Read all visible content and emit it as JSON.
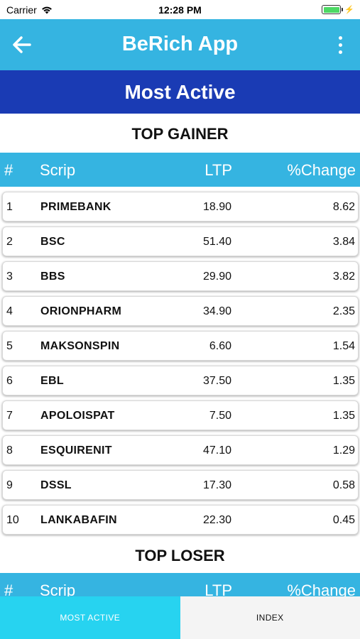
{
  "status_bar": {
    "carrier": "Carrier",
    "time": "12:28 PM"
  },
  "app_bar": {
    "title": "BeRich App",
    "back_icon": "arrow-left-icon",
    "menu_icon": "more-vertical-icon"
  },
  "section": {
    "title": "Most Active"
  },
  "columns": {
    "num": "#",
    "scrip": "Scrip",
    "ltp": "LTP",
    "change": "%Change"
  },
  "top_gainer": {
    "title": "TOP GAINER",
    "rows": [
      {
        "num": "1",
        "scrip": "PRIMEBANK",
        "ltp": "18.90",
        "change": "8.62"
      },
      {
        "num": "2",
        "scrip": "BSC",
        "ltp": "51.40",
        "change": "3.84"
      },
      {
        "num": "3",
        "scrip": "BBS",
        "ltp": "29.90",
        "change": "3.82"
      },
      {
        "num": "4",
        "scrip": "ORIONPHARM",
        "ltp": "34.90",
        "change": "2.35"
      },
      {
        "num": "5",
        "scrip": "MAKSONSPIN",
        "ltp": "6.60",
        "change": "1.54"
      },
      {
        "num": "6",
        "scrip": "EBL",
        "ltp": "37.50",
        "change": "1.35"
      },
      {
        "num": "7",
        "scrip": "APOLOISPAT",
        "ltp": "7.50",
        "change": "1.35"
      },
      {
        "num": "8",
        "scrip": "ESQUIRENIT",
        "ltp": "47.10",
        "change": "1.29"
      },
      {
        "num": "9",
        "scrip": "DSSL",
        "ltp": "17.30",
        "change": "0.58"
      },
      {
        "num": "10",
        "scrip": "LANKABAFIN",
        "ltp": "22.30",
        "change": "0.45"
      }
    ]
  },
  "top_loser": {
    "title": "TOP LOSER"
  },
  "tabs": [
    {
      "label": "MOST ACTIVE",
      "active": true
    },
    {
      "label": "INDEX",
      "active": false
    }
  ],
  "colors": {
    "app_bar": "#35b4e1",
    "banner": "#1a3bb4",
    "tab_active": "#27d3f0"
  }
}
